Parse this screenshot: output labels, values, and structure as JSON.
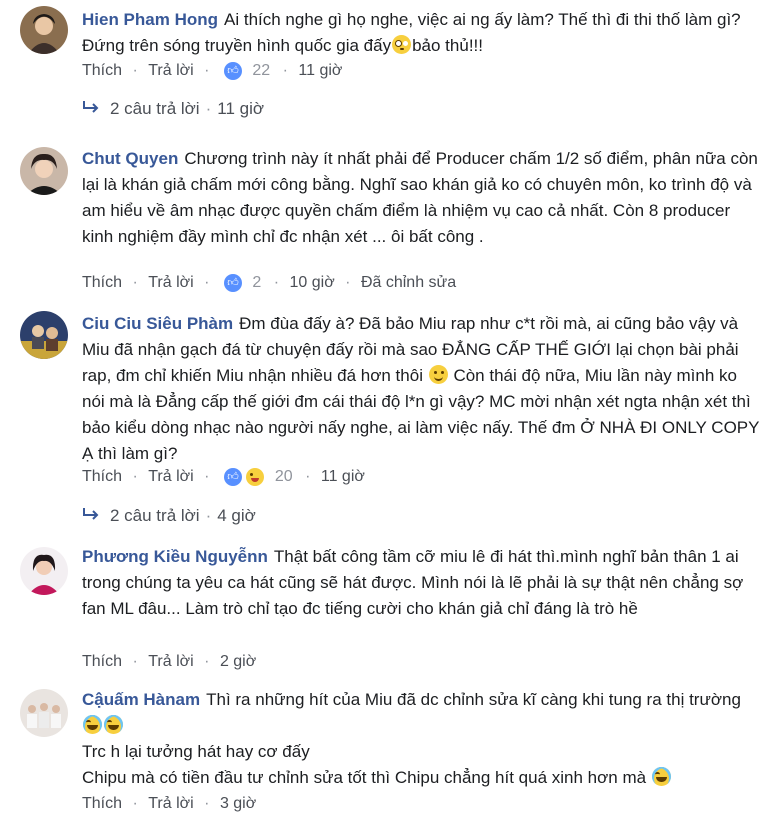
{
  "labels": {
    "like": "Thích",
    "reply": "Trả lời",
    "dot": "·"
  },
  "comments": [
    {
      "author": "Hien Pham Hong",
      "text_parts": [
        "Ai thích nghe gì họ nghe, việc ai ng ấy làm? Thế thì đi thi thố làm gì? Đứng trên sóng truyền hình quốc gia đấy",
        "bảo thủ!!!"
      ],
      "emoji": "flushed",
      "reactions": {
        "count": "22",
        "types": [
          "like"
        ]
      },
      "time": "11 giờ",
      "edited": "",
      "replies": {
        "label": "2 câu trả lời",
        "time": "11 giờ"
      }
    },
    {
      "author": "Chut Quyen",
      "text_parts": [
        "Chương trình này ít nhất phải để Producer chấm 1/2 số điểm, phân nữa còn lại là khán giả chấm mới công bằng. Nghĩ sao khán giả ko có chuyên môn, ko trình độ và am hiểu về âm nhạc được quyền chấm điểm là nhiệm vụ cao cả nhất. Còn 8 producer kinh nghiệm đầy mình chỉ đc nhận xét ... ôi bất công ."
      ],
      "reactions": {
        "count": "2",
        "types": [
          "like"
        ]
      },
      "time": "10 giờ",
      "edited": "Đã chỉnh sửa"
    },
    {
      "author": "Ciu Ciu Siêu Phàm",
      "text_parts": [
        "Đm đùa đấy à? Đã bảo Miu rap như c*t rồi mà, ai cũng bảo vậy và Miu đã nhận gạch đá từ chuyện đấy rồi mà sao ĐẲNG CẤP THẾ GIỚI lại chọn bài phải rap, đm chỉ khiến Miu nhận nhiều đá hơn thôi",
        " Còn thái độ nữa, Miu lần này mình ko nói mà là Đẳng cấp thế giới đm cái thái độ l*n gì vậy? MC mời nhận xét ngta nhận xét thì bảo kiểu dòng nhạc nào người nấy nghe, ai làm việc nấy. Thế đm Ở NHÀ ĐI ONLY COPY Ạ thì làm gì?"
      ],
      "emoji": "smile",
      "reactions": {
        "count": "20",
        "types": [
          "like",
          "haha"
        ]
      },
      "time": "11 giờ",
      "edited": "",
      "replies": {
        "label": "2 câu trả lời",
        "time": "4 giờ"
      }
    },
    {
      "author": "Phương Kiều Nguyễnn",
      "text_parts": [
        "Thật bất công tầm cỡ miu lê đi hát thì.mình nghĩ bản thân 1 ai trong chúng ta yêu ca hát cũng sẽ hát được. Mình nói là lẽ phải là sự thật nên chẳng sợ fan ML đâu... Làm trò chỉ tạo đc tiếng cười cho khán giả chỉ đáng là trò hề"
      ],
      "time": "2 giờ",
      "edited": ""
    },
    {
      "author": "Cậuấm Hànam",
      "text_parts": [
        "Thì ra những hít của Miu đã dc chỉnh sửa kĩ càng khi tung ra thị trường"
      ],
      "line2": "Trc h lại tưởng hát hay cơ đấy",
      "line3": "Chipu mà có tiền đầu tư chỉnh sửa tốt thì Chipu chẳng hít quá xinh hơn mà",
      "time": "3 giờ",
      "edited": ""
    }
  ]
}
